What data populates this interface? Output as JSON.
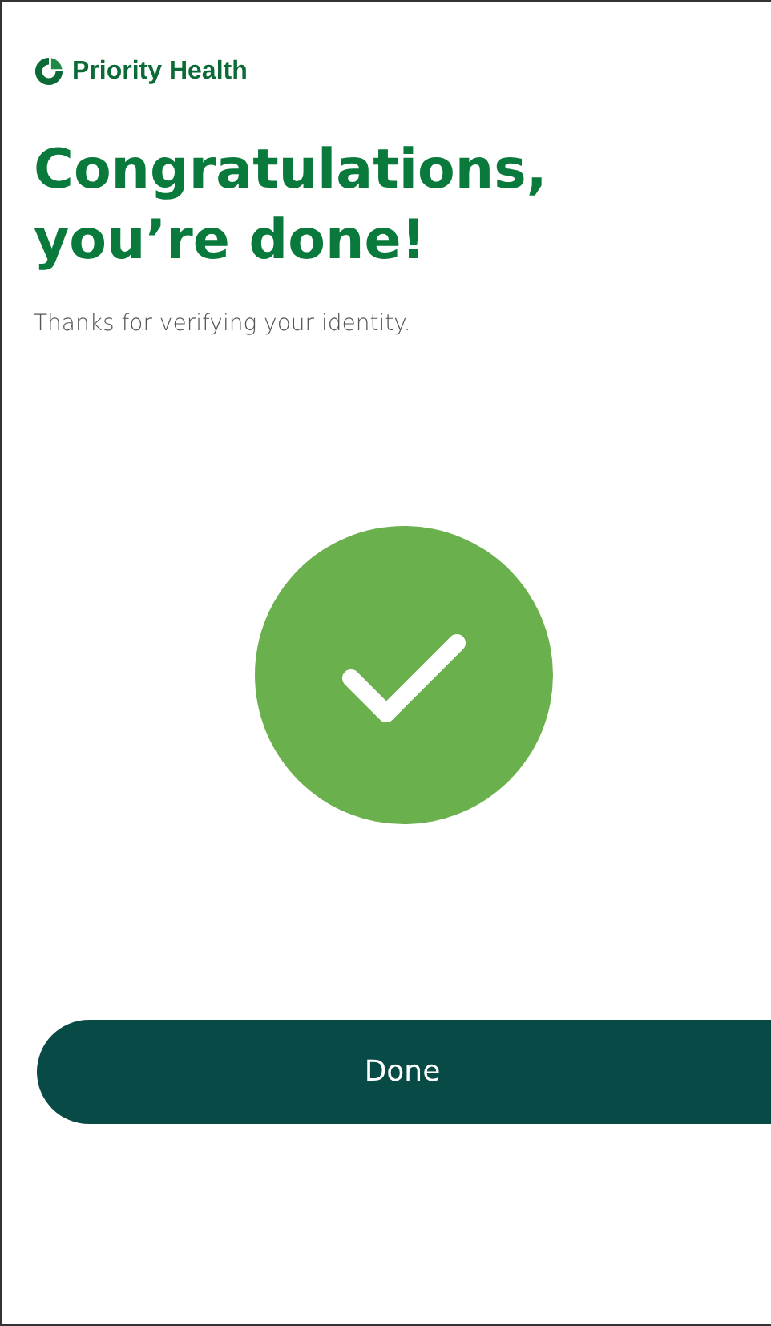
{
  "logo": {
    "text": "Priority Health"
  },
  "heading": "Congratulations, you’re done!",
  "message": "Thanks for verifying your identity.",
  "status": {
    "kind": "success"
  },
  "buttons": [
    {
      "label": "Done"
    }
  ]
}
